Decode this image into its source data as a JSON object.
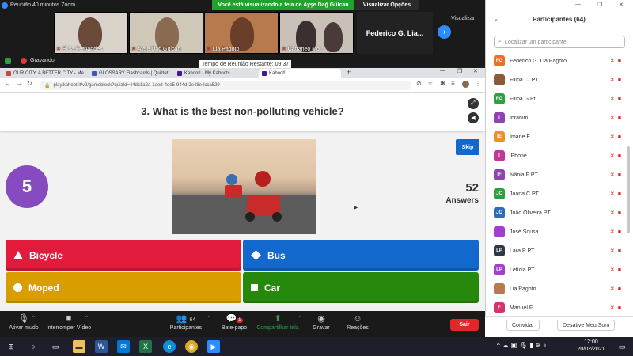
{
  "zoom": {
    "window_title": "Reunião 40 minutos Zoom",
    "share_banner": "Você está visualizando a tela de Ayşe Dağ Gülcan",
    "view_options": "Visualizar Opções",
    "view_label": "Visualizar",
    "recording_label": "Gravando",
    "timer_label": "Tempo de Reunião Restante: 09:37"
  },
  "video_tiles": [
    {
      "name": "Elisa Fernandes",
      "bg": "#d9d3cc"
    },
    {
      "name": "Ayşe Dağ Gülcan",
      "bg": "#cfc8b9"
    },
    {
      "name": "Lia Pagoto",
      "bg": "#b77a4e"
    },
    {
      "name": "Cattaneo Mo...",
      "bg": "#c9c1b7"
    }
  ],
  "speaker_tile": "Federico G. Lia...",
  "browser": {
    "tabs": [
      {
        "label": "OUR CITY, A BETTER CITY - Me"
      },
      {
        "label": "GLOSSARY Flashcards | Quizlet"
      },
      {
        "label": "Kahoot! - My Kahoots"
      },
      {
        "label": "Kahoot!"
      }
    ],
    "url": "play.kahoot.it/v2/gameblock?quizId=44dc1a2a-1aed-4de5-944d-2e48e4cca529"
  },
  "kahoot": {
    "question": "3. What is the best non-polluting vehicle?",
    "timer": "5",
    "skip_label": "Skip",
    "answer_count": "52",
    "answer_label": "Answers",
    "answers": [
      {
        "label": "Bicycle",
        "color": "#e21b3c",
        "shape": "triangle"
      },
      {
        "label": "Bus",
        "color": "#1368ce",
        "shape": "diamond"
      },
      {
        "label": "Moped",
        "color": "#d89e00",
        "shape": "circle"
      },
      {
        "label": "Car",
        "color": "#26890c",
        "shape": "square"
      }
    ]
  },
  "toolbar": {
    "mute": "Ativar mudo",
    "video": "Interromper Vídeo",
    "participants": "Participantes",
    "participants_count": "64",
    "chat": "Bate-papo",
    "chat_badge": "1",
    "share": "Compartilhar tela",
    "record": "Gravar",
    "reactions": "Reações",
    "end": "Sair"
  },
  "panel": {
    "title": "Participantes (64)",
    "search_placeholder": "Localizar um participante",
    "participants": [
      {
        "initials": "FG",
        "name": "Federico G. Lia Pagoto",
        "color": "#e8722a"
      },
      {
        "initials": "",
        "name": "Filipa C. PT",
        "color": "#8a5a3a"
      },
      {
        "initials": "FG",
        "name": "Filipa G Pt",
        "color": "#2ea043"
      },
      {
        "initials": "I",
        "name": "Ibrahim",
        "color": "#8e44ad"
      },
      {
        "initials": "IE",
        "name": "Imane E.",
        "color": "#e8922a"
      },
      {
        "initials": "I",
        "name": "iPhone",
        "color": "#c0399a"
      },
      {
        "initials": "IF",
        "name": "Ivânia F PT",
        "color": "#8e44ad"
      },
      {
        "initials": "JC",
        "name": "Joana C PT",
        "color": "#2ea043"
      },
      {
        "initials": "JO",
        "name": "João Oliveira PT",
        "color": "#2d6db5"
      },
      {
        "initials": "",
        "name": "José Sousa",
        "color": "#a23ed0"
      },
      {
        "initials": "LP",
        "name": "Lara P PT",
        "color": "#2f3a48"
      },
      {
        "initials": "LP",
        "name": "Letícia PT",
        "color": "#a23ed0"
      },
      {
        "initials": "",
        "name": "Lia Pagoto",
        "color": "#b77a4e"
      },
      {
        "initials": "F",
        "name": "Manuel F.",
        "color": "#d6336c"
      }
    ],
    "invite": "Convidar",
    "unmute": "Desative Meu Som"
  },
  "taskbar": {
    "time": "12:00",
    "date": "20/02/2021"
  }
}
